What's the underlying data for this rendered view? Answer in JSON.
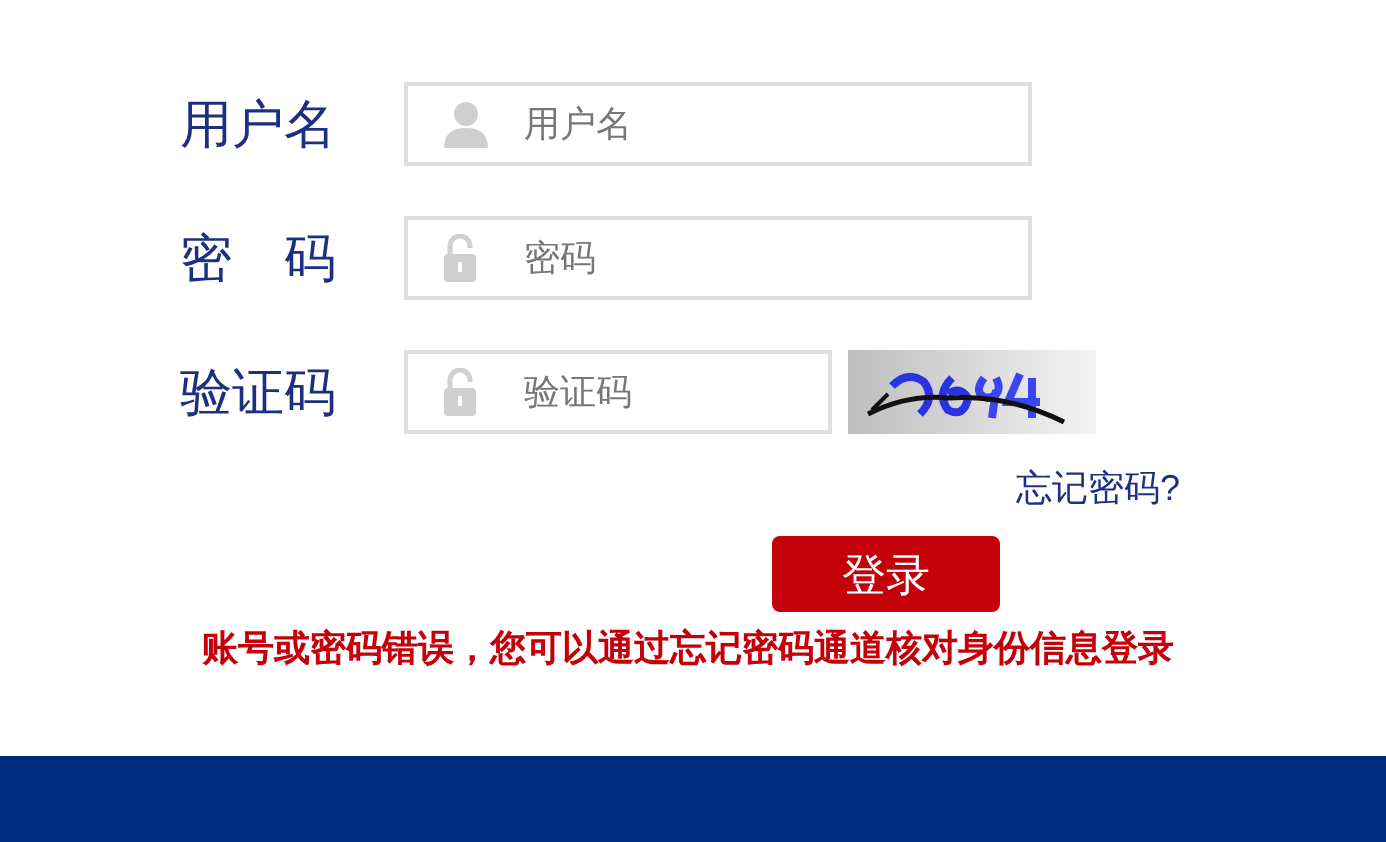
{
  "fields": [
    {
      "label": "用户名",
      "placeholder": "用户名",
      "kind": "user"
    },
    {
      "label": "密　码",
      "placeholder": "密码",
      "kind": "password"
    },
    {
      "label": "验证码",
      "placeholder": "验证码",
      "kind": "captcha"
    }
  ],
  "forgot_link": "忘记密码?",
  "login_button": "登录",
  "error_message": "账号或密码错误，您可以通过忘记密码通道核对身份信息登录"
}
